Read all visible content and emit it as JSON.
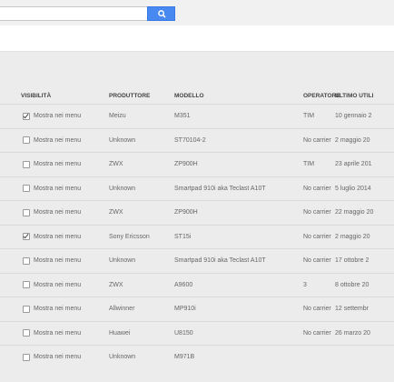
{
  "search": {
    "value": "",
    "placeholder": ""
  },
  "table": {
    "headers": {
      "visibility": "VISIBILITÀ",
      "manufacturer": "PRODUTTORE",
      "model": "MODELLO",
      "carrier": "OPERATORE",
      "last_used": "ULTIMO UTILI"
    },
    "rows": [
      {
        "checked": true,
        "label": "Mostra nei menu",
        "manufacturer": "Meizu",
        "model": "M351",
        "carrier": "TIM",
        "last_used": "10 gennaio 2"
      },
      {
        "checked": false,
        "label": "Mostra nei menu",
        "manufacturer": "Unknown",
        "model": "ST70104-2",
        "carrier": "No carrier",
        "last_used": "2 maggio 20"
      },
      {
        "checked": false,
        "label": "Mostra nei menu",
        "manufacturer": "ZWX",
        "model": "ZP900H",
        "carrier": "TIM",
        "last_used": "23 aprile 201"
      },
      {
        "checked": false,
        "label": "Mostra nei menu",
        "manufacturer": "Unknown",
        "model": "Smartpad 910i aka Teclast A10T",
        "carrier": "No carrier",
        "last_used": "5 luglio 2014"
      },
      {
        "checked": false,
        "label": "Mostra nei menu",
        "manufacturer": "ZWX",
        "model": "ZP900H",
        "carrier": "No carrier",
        "last_used": "22 maggio 20"
      },
      {
        "checked": true,
        "label": "Mostra nei menu",
        "manufacturer": "Sony Ericsson",
        "model": "ST15i",
        "carrier": "No carrier",
        "last_used": "2 maggio 20"
      },
      {
        "checked": false,
        "label": "Mostra nei menu",
        "manufacturer": "Unknown",
        "model": "Smartpad 910i aka Teclast A10T",
        "carrier": "No carrier",
        "last_used": "17 ottobre 2"
      },
      {
        "checked": false,
        "label": "Mostra nei menu",
        "manufacturer": "ZWX",
        "model": "A9600",
        "carrier": "3",
        "last_used": "8 ottobre 20"
      },
      {
        "checked": false,
        "label": "Mostra nei menu",
        "manufacturer": "Allwinner",
        "model": "MP910i",
        "carrier": "No carrier",
        "last_used": "12 settembr"
      },
      {
        "checked": false,
        "label": "Mostra nei menu",
        "manufacturer": "Huawei",
        "model": "U8150",
        "carrier": "No carrier",
        "last_used": "26 marzo 20"
      },
      {
        "checked": false,
        "label": "Mostra nei menu",
        "manufacturer": "Unknown",
        "model": "M971B",
        "carrier": "",
        "last_used": ""
      }
    ]
  }
}
